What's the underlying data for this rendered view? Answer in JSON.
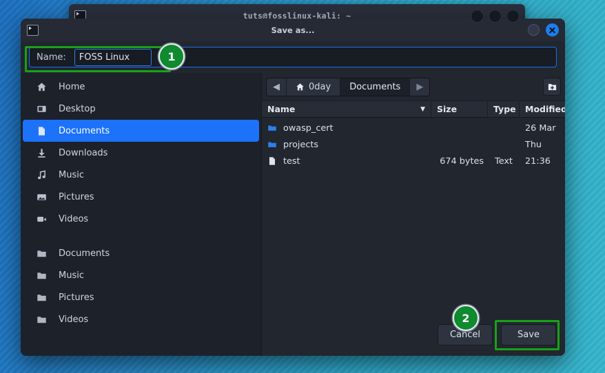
{
  "desktop": {
    "background_gradient_start": "#1b6fc0",
    "background_gradient_end": "#35b6cd"
  },
  "background_window": {
    "title": "tuts@fosslinux-kali: ~",
    "app_icon": "terminal-icon",
    "buttons": [
      "minimize-button",
      "maximize-button",
      "close-button"
    ]
  },
  "dialog": {
    "title": "Save as...",
    "app_icon": "terminal-icon",
    "minimize_label": "",
    "close_label": "",
    "name_field": {
      "label": "Name:",
      "value": "FOSS Linux",
      "placeholder": "",
      "focus_color": "#1a72f0"
    },
    "path_bar": {
      "back_arrow": "◀",
      "forward_arrow": "▶",
      "crumbs": [
        {
          "label": "0day",
          "icon": "home-icon",
          "active": false
        },
        {
          "label": "Documents",
          "icon": "",
          "active": true
        }
      ],
      "new_folder_label": "new-folder-button"
    },
    "sidebar": {
      "places": [
        {
          "label": "Home",
          "icon": "home-icon",
          "selected": false
        },
        {
          "label": "Desktop",
          "icon": "desktop-icon",
          "selected": false
        },
        {
          "label": "Documents",
          "icon": "document-icon",
          "selected": true
        },
        {
          "label": "Downloads",
          "icon": "download-icon",
          "selected": false
        },
        {
          "label": "Music",
          "icon": "music-icon",
          "selected": false
        },
        {
          "label": "Pictures",
          "icon": "picture-icon",
          "selected": false
        },
        {
          "label": "Videos",
          "icon": "video-icon",
          "selected": false
        }
      ],
      "bookmarks": [
        {
          "label": "Documents",
          "icon": "folder-icon"
        },
        {
          "label": "Music",
          "icon": "folder-icon"
        },
        {
          "label": "Pictures",
          "icon": "folder-icon"
        },
        {
          "label": "Videos",
          "icon": "folder-icon"
        }
      ]
    },
    "file_list": {
      "columns": [
        "Name",
        "Size",
        "Type",
        "Modified"
      ],
      "sort_indicator": "▼",
      "rows": [
        {
          "name": "owasp_cert",
          "size": "",
          "type": "",
          "modified": "26 Mar",
          "icon": "folder-icon"
        },
        {
          "name": "projects",
          "size": "",
          "type": "",
          "modified": "Thu",
          "icon": "folder-icon"
        },
        {
          "name": "test",
          "size": "674 bytes",
          "type": "Text",
          "modified": "21:36",
          "icon": "file-icon"
        }
      ]
    },
    "actions": {
      "cancel_label": "Cancel",
      "save_label": "Save"
    }
  },
  "annotations": {
    "badges": [
      {
        "number": "1",
        "color": "#0f8a2e",
        "target": "name-field"
      },
      {
        "number": "2",
        "color": "#0f8a2e",
        "target": "save-button"
      }
    ],
    "highlight_color": "#17a317"
  }
}
